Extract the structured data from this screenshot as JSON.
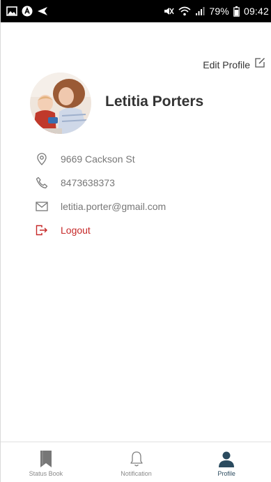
{
  "status_bar": {
    "battery": "79%",
    "time": "09:42"
  },
  "header": {
    "edit_label": "Edit Profile"
  },
  "profile": {
    "name": "Letitia Porters",
    "address": "9669 Cackson St",
    "phone": "8473638373",
    "email": "letitia.porter@gmail.com",
    "logout_label": "Logout"
  },
  "bottom_nav": {
    "items": [
      {
        "label": "Status Book",
        "icon": "bookmark-icon",
        "active": false
      },
      {
        "label": "Notification",
        "icon": "bell-icon",
        "active": false
      },
      {
        "label": "Profile",
        "icon": "person-icon",
        "active": true
      }
    ]
  },
  "colors": {
    "accent": "#2b4b5f",
    "logout": "#c62828",
    "icon_gray": "#777777",
    "nav_inactive": "#808080"
  }
}
